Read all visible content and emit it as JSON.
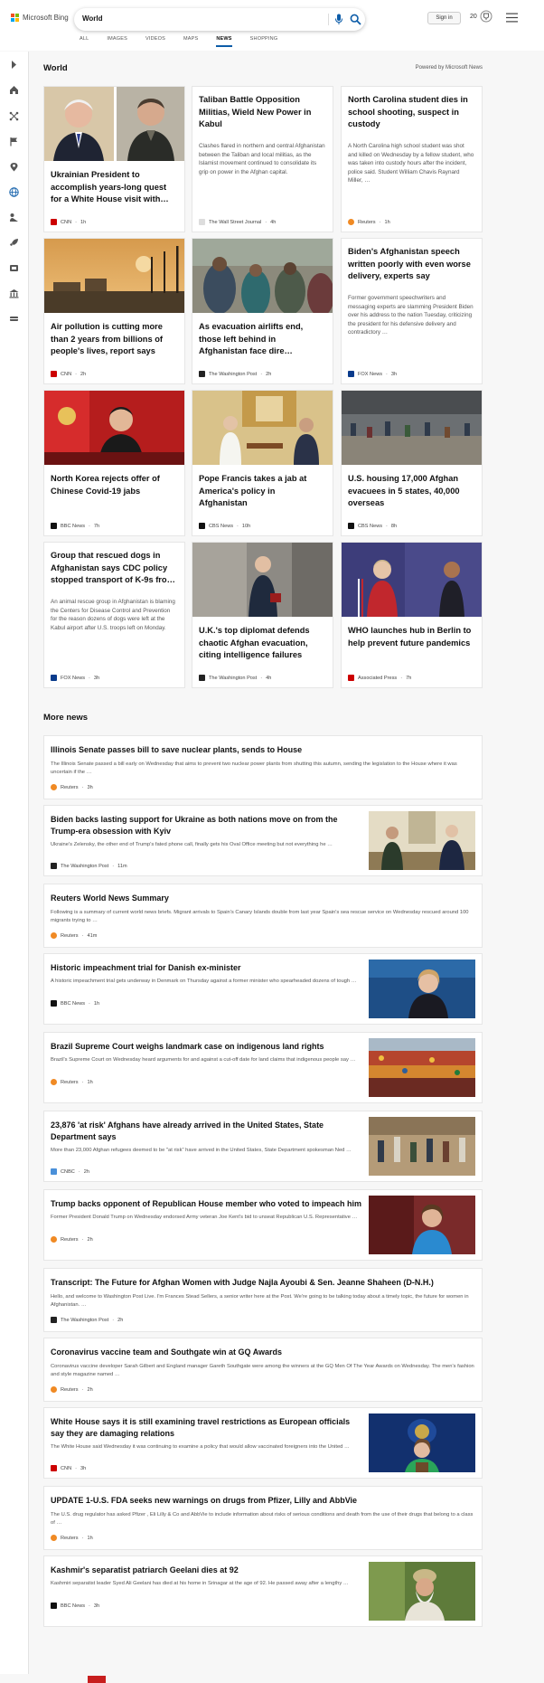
{
  "header": {
    "logo_text": "Microsoft Bing",
    "logo_colors": [
      "#f25022",
      "#7fba00",
      "#00a4ef",
      "#ffb900"
    ],
    "search_value": "World",
    "sign_in": "Sign in",
    "rewards_count": "20",
    "accent": "#0c5ca8"
  },
  "tabs": [
    "ALL",
    "IMAGES",
    "VIDEOS",
    "MAPS",
    "NEWS",
    "SHOPPING"
  ],
  "active_tab": "NEWS",
  "sidebar_icons": [
    "chevron-right-icon",
    "home-icon",
    "network-icon",
    "flag-icon",
    "location-pin-icon",
    "globe-icon",
    "business-icon",
    "rocket-icon",
    "entertainment-icon",
    "bank-icon",
    "car-icon"
  ],
  "section": {
    "title": "World",
    "powered_by": "Powered by Microsoft News"
  },
  "cards": [
    {
      "title": "Ukrainian President to accomplish years-long quest for a White House visit with…",
      "snippet": "",
      "source": "CNN",
      "time": "1h",
      "source_color": "#cc0000"
    },
    {
      "title": "Taliban Battle Opposition Militias, Wield New Power in Kabul",
      "snippet": "Clashes flared in northern and central Afghanistan between the Taliban and local militias, as the Islamist movement continued to consolidate its grip on power in the Afghan capital.",
      "source": "The Wall Street Journal",
      "time": "4h",
      "source_color": "#777777"
    },
    {
      "title": "North Carolina student dies in school shooting, suspect in custody",
      "snippet": "A North Carolina high school student was shot and killed on Wednesday by a fellow student, who was taken into custody hours after the incident, police said. Student William Chavis Raynard Miller, …",
      "source": "Reuters",
      "time": "1h",
      "source_color": "#f08a24"
    },
    {
      "title": "Air pollution is cutting more than 2 years from billions of people's lives, report says",
      "snippet": "",
      "source": "CNN",
      "time": "2h",
      "source_color": "#cc0000"
    },
    {
      "title": "As evacuation airlifts end, those left behind in Afghanistan face dire…",
      "snippet": "",
      "source": "The Washington Post",
      "time": "2h",
      "source_color": "#222222"
    },
    {
      "title": "Biden's Afghanistan speech written poorly with even worse delivery, experts say",
      "snippet": "Former government speechwriters and messaging experts are slamming President Biden over his address to the nation Tuesday, criticizing the president for his defensive delivery and contradictory …",
      "source": "FOX News",
      "time": "3h",
      "source_color": "#0a3b8c"
    },
    {
      "title": "North Korea rejects offer of Chinese Covid-19 jabs",
      "snippet": "",
      "source": "BBC News",
      "time": "7h",
      "source_color": "#111111"
    },
    {
      "title": "Pope Francis takes a jab at America's policy in Afghanistan",
      "snippet": "",
      "source": "CBS News",
      "time": "10h",
      "source_color": "#111111"
    },
    {
      "title": "U.S. housing 17,000 Afghan evacuees in 5 states, 40,000 overseas",
      "snippet": "",
      "source": "CBS News",
      "time": "8h",
      "source_color": "#111111"
    },
    {
      "title": "Group that rescued dogs in Afghanistan says CDC policy stopped transport of K-9s fro…",
      "snippet": "An animal rescue group in Afghanistan is blaming the Centers for Disease Control and Prevention for the reason dozens of dogs were left at the Kabul airport after U.S. troops left on Monday.",
      "source": "FOX News",
      "time": "3h",
      "source_color": "#0a3b8c"
    },
    {
      "title": "U.K.'s top diplomat defends chaotic Afghan evacuation, citing intelligence failures",
      "snippet": "",
      "source": "The Washington Post",
      "time": "4h",
      "source_color": "#222222"
    },
    {
      "title": "WHO launches hub in Berlin to help prevent future pandemics",
      "snippet": "",
      "source": "Associated Press",
      "time": "7h",
      "source_color": "#cc0000"
    }
  ],
  "more_news_title": "More news",
  "more_news": [
    {
      "title": "Illinois Senate passes bill to save nuclear plants, sends to House",
      "snippet": "The Illinois Senate passed a bill early on Wednesday that aims to prevent two nuclear power plants from shutting this autumn, sending the legislation to the House where it was uncertain if the …",
      "source": "Reuters",
      "time": "3h",
      "source_color": "#f08a24"
    },
    {
      "title": "Biden backs lasting support for Ukraine as both nations move on from the Trump-era obsession with Kyiv",
      "snippet": "Ukraine's Zelensky, the other end of Trump's fated phone call, finally gets his Oval Office meeting but not everything he …",
      "source": "The Washington Post",
      "time": "11m",
      "source_color": "#222222"
    },
    {
      "title": "Reuters World News Summary",
      "snippet": "Following is a summary of current world news briefs. Migrant arrivals to Spain's Canary Islands double from last year Spain's sea rescue service on Wednesday rescued around 100 migrants trying to …",
      "source": "Reuters",
      "time": "41m",
      "source_color": "#f08a24"
    },
    {
      "title": "Historic impeachment trial for Danish ex-minister",
      "snippet": "A historic impeachment trial gets underway in Denmark on Thursday against a former minister who spearheaded dozens of tough …",
      "source": "BBC News",
      "time": "1h",
      "source_color": "#111111"
    },
    {
      "title": "Brazil Supreme Court weighs landmark case on indigenous land rights",
      "snippet": "Brazil's Supreme Court on Wednesday heard arguments for and against a cut-off date for land claims that indigenous people say …",
      "source": "Reuters",
      "time": "1h",
      "source_color": "#f08a24"
    },
    {
      "title": "23,876 'at risk' Afghans have already arrived in the United States, State Department says",
      "snippet": "More than 23,000 Afghan refugees deemed to be \"at risk\" have arrived in the United States, State Department spokesman Ned …",
      "source": "CNBC",
      "time": "2h",
      "source_color": "#4a90d9"
    },
    {
      "title": "Trump backs opponent of Republican House member who voted to impeach him",
      "snippet": "Former President Donald Trump on Wednesday endorsed Army veteran Joe Kent's bid to unseat Republican U.S. Representative …",
      "source": "Reuters",
      "time": "2h",
      "source_color": "#f08a24"
    },
    {
      "title": "Transcript: The Future for Afghan Women with Judge Najla Ayoubi & Sen. Jeanne Shaheen (D-N.H.)",
      "snippet": "Hello, and welcome to Washington Post Live. I'm Frances Stead Sellers, a senior writer here at the Post. We're going to be talking today about a timely topic, the future for women in Afghanistan. …",
      "source": "The Washington Post",
      "time": "2h",
      "source_color": "#222222"
    },
    {
      "title": "Coronavirus vaccine team and Southgate win at GQ Awards",
      "snippet": "Coronavirus vaccine developer Sarah Gilbert and England manager Gareth Southgate were among the winners at the GQ Men Of The Year Awards on Wednesday. The men's fashion and style magazine named …",
      "source": "Reuters",
      "time": "2h",
      "source_color": "#f08a24"
    },
    {
      "title": "White House says it is still examining travel restrictions as European officials say they are damaging relations",
      "snippet": "The White House said Wednesday it was continuing to examine a policy that would allow vaccinated foreigners into the United …",
      "source": "CNN",
      "time": "3h",
      "source_color": "#cc0000"
    },
    {
      "title": "UPDATE 1-U.S. FDA seeks new warnings on drugs from Pfizer, Lilly and AbbVie",
      "snippet": "The U.S. drug regulator has asked Pfizer , Eli Lilly & Co and AbbVie to include information about risks of serious conditions and death from the use of their drugs that belong to a class of …",
      "source": "Reuters",
      "time": "1h",
      "source_color": "#f08a24"
    },
    {
      "title": "Kashmir's separatist patriarch Geelani dies at 92",
      "snippet": "Kashmiri separatist leader Syed Ali Geelani has died at his home in Srinagar at the age of 92. He passed away after a lengthy …",
      "source": "BBC News",
      "time": "3h",
      "source_color": "#111111"
    }
  ]
}
